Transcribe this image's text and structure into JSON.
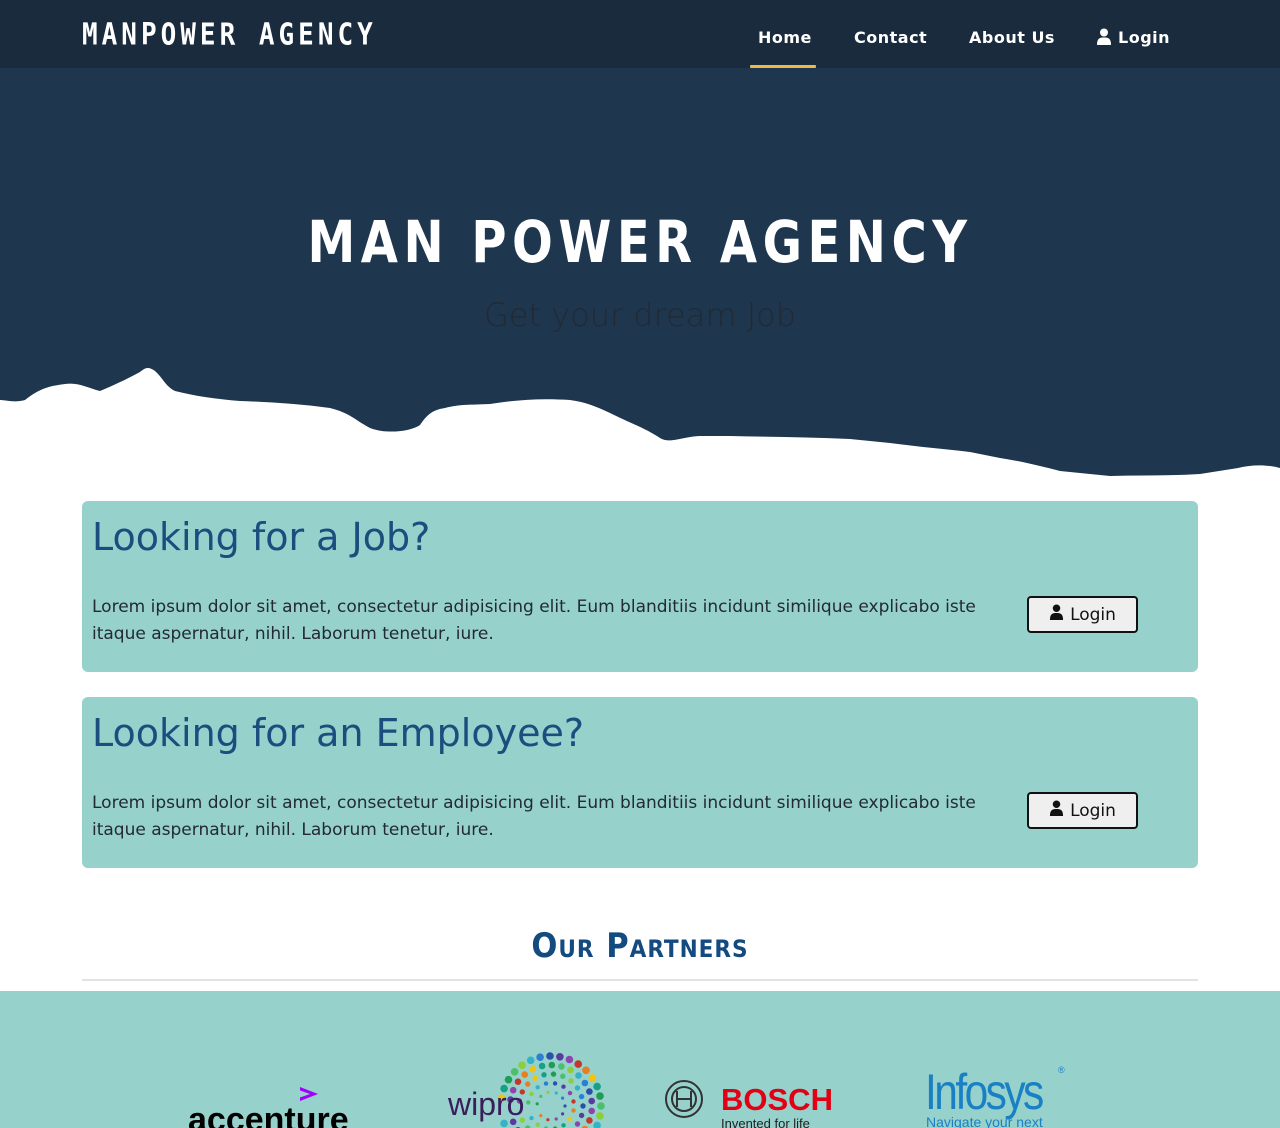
{
  "navbar": {
    "brand": "MANPOWER AGENCY",
    "items": [
      {
        "label": "Home",
        "active": true
      },
      {
        "label": "Contact",
        "active": false
      },
      {
        "label": "About Us",
        "active": false
      },
      {
        "label": "Login",
        "icon": "user-icon",
        "active": false
      }
    ]
  },
  "hero": {
    "title": "MAN POWER AGENCY",
    "subtitle": "Get your dream Job"
  },
  "cards": [
    {
      "title": "Looking for a Job?",
      "text": "Lorem ipsum dolor sit amet, consectetur adipisicing elit. Eum blanditiis incidunt similique explicabo iste itaque aspernatur, nihil. Laborum tenetur, iure.",
      "button": "Login"
    },
    {
      "title": "Looking for an Employee?",
      "text": "Lorem ipsum dolor sit amet, consectetur adipisicing elit. Eum blanditiis incidunt similique explicabo iste itaque aspernatur, nihil. Laborum tenetur, iure.",
      "button": "Login"
    }
  ],
  "partners": {
    "title": "Our Partners",
    "logos": [
      {
        "name": "accenture",
        "text": "accenture"
      },
      {
        "name": "wipro",
        "text": "wipro"
      },
      {
        "name": "bosch",
        "text": "BOSCH",
        "tagline": "Invented for life"
      },
      {
        "name": "infosys",
        "text": "Infosys",
        "tagline": "Navigate your next"
      }
    ]
  },
  "colors": {
    "navbar": "#1a2b3e",
    "hero": "#1e364e",
    "active_underline": "#f0b844",
    "card_bg": "#96d1cb",
    "card_title": "#1b4e7e",
    "partners_title": "#134a80"
  }
}
